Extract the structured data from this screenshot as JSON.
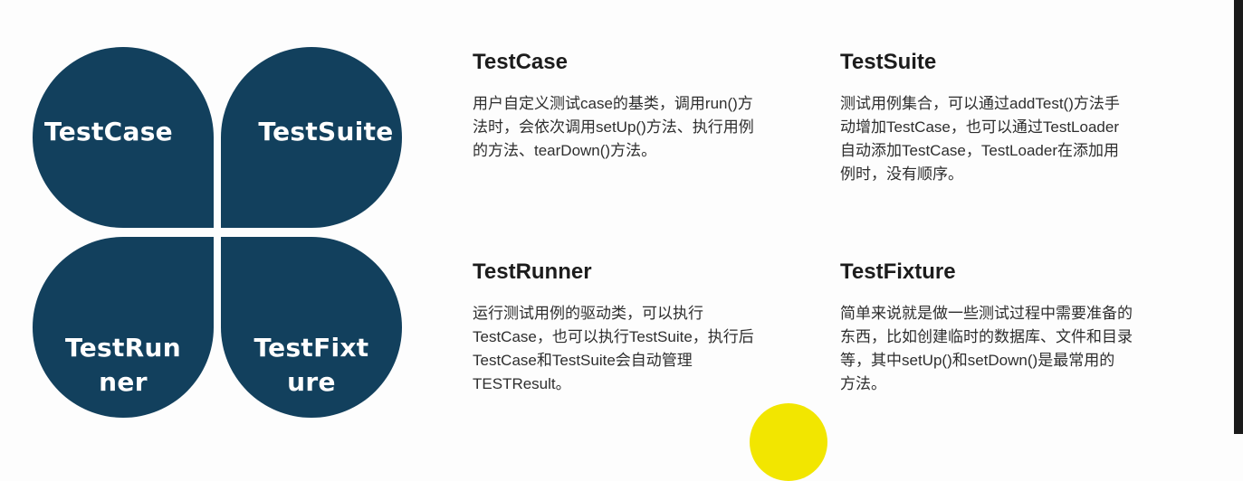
{
  "petals": {
    "testcase": "TestCase",
    "testsuite": "TestSuite",
    "testrunner": "TestRun\nner",
    "testfixture": "TestFixt\nure"
  },
  "sections": {
    "testcase": {
      "title": "TestCase",
      "text": "用户自定义测试case的基类，调用run()方\n法时，会依次调用setUp()方法、执行用例\n的方法、tearDown()方法。"
    },
    "testsuite": {
      "title": "TestSuite",
      "text": "测试用例集合，可以通过addTest()方法手\n动增加TestCase，也可以通过TestLoader\n自动添加TestCase，TestLoader在添加用\n例时，没有顺序。"
    },
    "testrunner": {
      "title": "TestRunner",
      "text": "运行测试用例的驱动类，可以执行\nTestCase，也可以执行TestSuite，执行后\nTestCase和TestSuite会自动管理\nTESTResult。"
    },
    "testfixture": {
      "title": "TestFixture",
      "text": "简单来说就是做一些测试过程中需要准备的\n东西，比如创建临时的数据库、文件和目录\n等，其中setUp()和setDown()是最常用的\n方法。"
    }
  },
  "colors": {
    "petal": "#12405d",
    "highlight": "#f2e600"
  }
}
